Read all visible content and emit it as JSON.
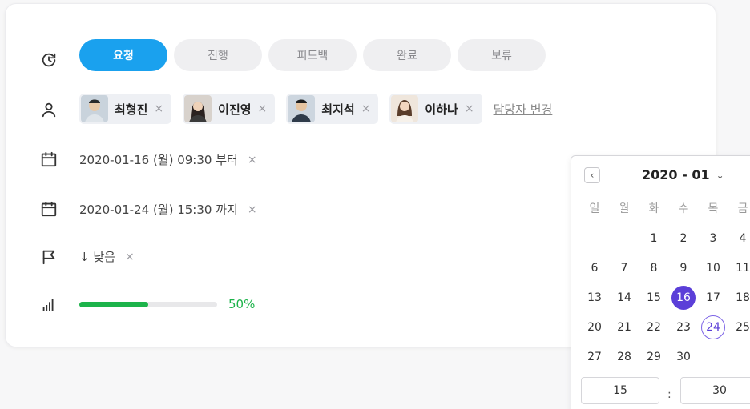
{
  "status": {
    "options": [
      "요청",
      "진행",
      "피드백",
      "완료",
      "보류"
    ],
    "active_index": 0
  },
  "assignees": {
    "people": [
      {
        "name": "최형진",
        "remove": "×"
      },
      {
        "name": "이진영",
        "remove": "×"
      },
      {
        "name": "최지석",
        "remove": "×"
      },
      {
        "name": "이하나",
        "remove": "×"
      }
    ],
    "change_link": "담당자 변경"
  },
  "start_date": {
    "text": "2020-01-16 (월) 09:30 부터",
    "remove": "×"
  },
  "end_date": {
    "text": "2020-01-24 (월) 15:30 까지",
    "remove": "×"
  },
  "priority": {
    "text": "↓ 낮음",
    "remove": "×"
  },
  "progress": {
    "value": 0.5,
    "label": "50%"
  },
  "calendar": {
    "prev": "‹",
    "title": "2020 - 01",
    "caret": "⌄",
    "weekdays": [
      "일",
      "월",
      "화",
      "수",
      "목",
      "금"
    ],
    "weeks": [
      [
        "",
        "",
        "1",
        "2",
        "3",
        "4"
      ],
      [
        "6",
        "7",
        "8",
        "9",
        "10",
        "11"
      ],
      [
        "13",
        "14",
        "15",
        "16",
        "17",
        "18"
      ],
      [
        "20",
        "21",
        "22",
        "23",
        "24",
        "25"
      ],
      [
        "27",
        "28",
        "29",
        "30",
        "",
        ""
      ]
    ],
    "selected_day": "16",
    "range_end_day": "24",
    "hour": "15",
    "colon": ":",
    "minute": "30"
  },
  "colors": {
    "accent": "#1aa1ee",
    "progress": "#1cb34a",
    "calendar_selected": "#5b3fd8"
  }
}
